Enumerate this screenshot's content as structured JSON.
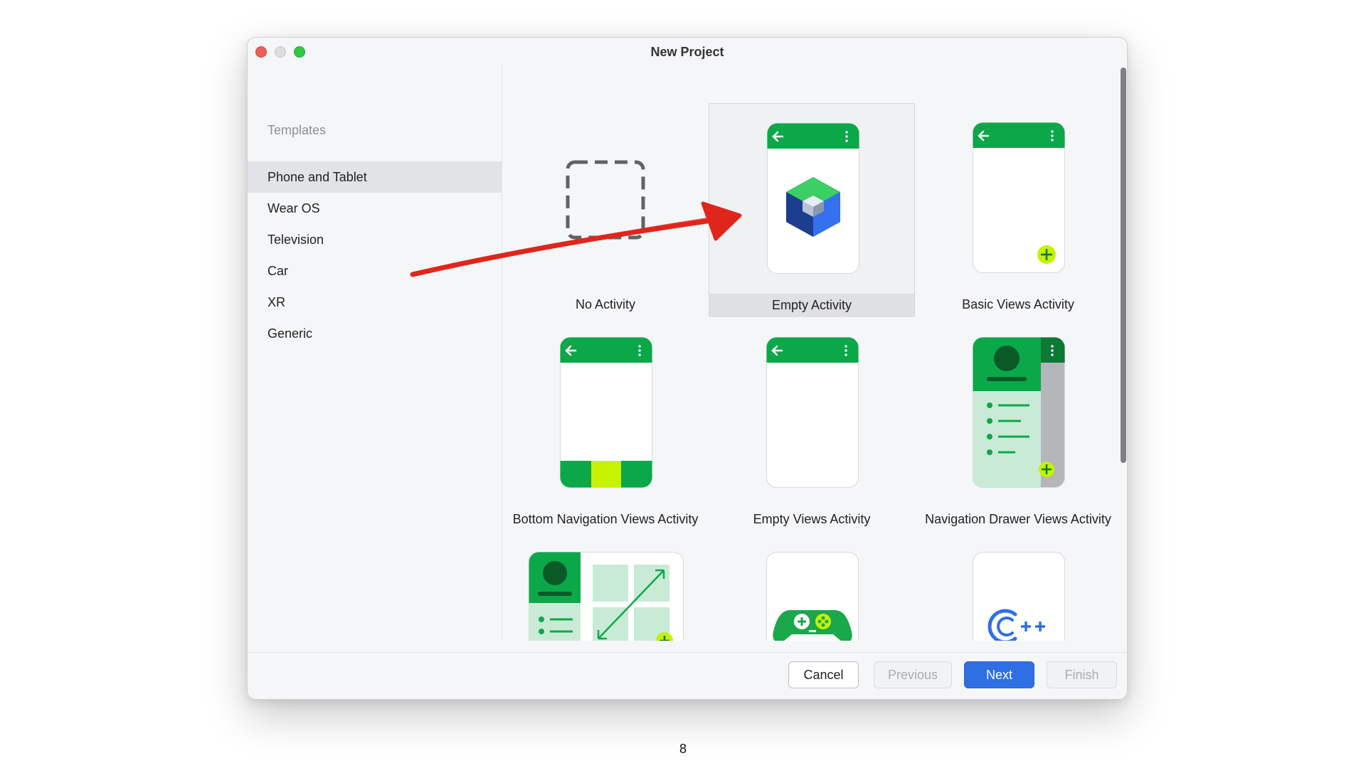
{
  "window": {
    "title": "New Project"
  },
  "sidebar": {
    "heading": "Templates",
    "items": [
      {
        "label": "Phone and Tablet",
        "selected": true
      },
      {
        "label": "Wear OS"
      },
      {
        "label": "Television"
      },
      {
        "label": "Car"
      },
      {
        "label": "XR"
      },
      {
        "label": "Generic"
      }
    ]
  },
  "templates": [
    {
      "label": "No Activity",
      "icon": "dashed-square-icon"
    },
    {
      "label": "Empty Activity",
      "icon": "jetpack-compose-cube-icon",
      "selected": true
    },
    {
      "label": "Basic Views Activity",
      "icon": "fab-plus-icon"
    },
    {
      "label": "Bottom Navigation Views Activity",
      "icon": "bottom-navigation-icon"
    },
    {
      "label": "Empty Views Activity",
      "icon": "empty-phone-icon"
    },
    {
      "label": "Navigation Drawer Views Activity",
      "icon": "navigation-drawer-icon"
    },
    {
      "label": "",
      "icon": "responsive-layout-icon"
    },
    {
      "label": "",
      "icon": "game-controller-icon"
    },
    {
      "label": "",
      "icon": "cpp-icon"
    }
  ],
  "footer": {
    "cancel": "Cancel",
    "previous": "Previous",
    "next": "Next",
    "finish": "Finish"
  },
  "page_number": "8",
  "colors": {
    "accent": "#2f6fe4",
    "green": "#0ba84a",
    "dark_green": "#0a7a35",
    "light_green": "#c9ebd6",
    "lime": "#c6f200",
    "annotation_red": "#e0261c"
  }
}
